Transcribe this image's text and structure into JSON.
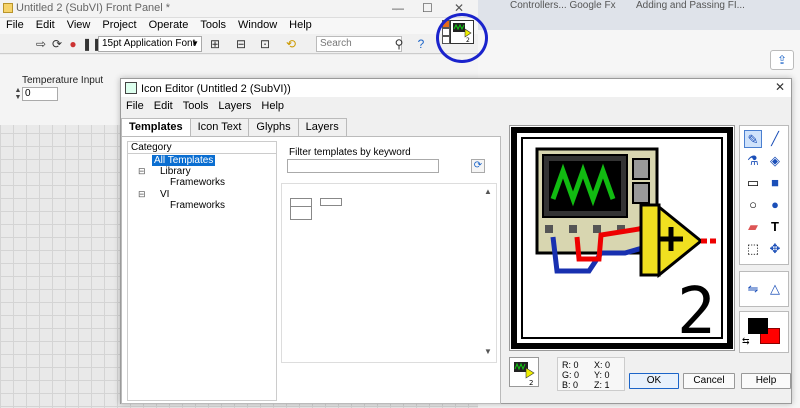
{
  "front_panel": {
    "title": "Untitled 2 (SubVI) Front Panel *",
    "menu": [
      "File",
      "Edit",
      "View",
      "Project",
      "Operate",
      "Tools",
      "Window",
      "Help"
    ],
    "font_select": "15pt Application Font",
    "search_placeholder": "Search",
    "control_label": "Temperature Input",
    "control_value": "0"
  },
  "browser": {
    "tab1": "Controllers... Google Fx",
    "tab2": "Adding and Passing FI..."
  },
  "dialog": {
    "title": "Icon Editor (Untitled 2 (SubVI))",
    "menu": [
      "File",
      "Edit",
      "Tools",
      "Layers",
      "Help"
    ],
    "tabs": [
      "Templates",
      "Icon Text",
      "Glyphs",
      "Layers"
    ],
    "category_header": "Category",
    "tree": {
      "all": "All Templates",
      "library": "Library",
      "library_frameworks": "Frameworks",
      "vi": "VI",
      "vi_frameworks": "Frameworks"
    },
    "filter_label": "Filter templates by keyword",
    "info": {
      "r": "R: 0",
      "g": "G: 0",
      "b": "B: 0",
      "x": "X: 0",
      "y": "Y: 0",
      "z": "Z: 1"
    },
    "buttons": {
      "ok": "OK",
      "cancel": "Cancel",
      "help": "Help"
    },
    "icon_number": "2",
    "colors": {
      "foreground": "#000000",
      "background": "#ff0000"
    }
  }
}
